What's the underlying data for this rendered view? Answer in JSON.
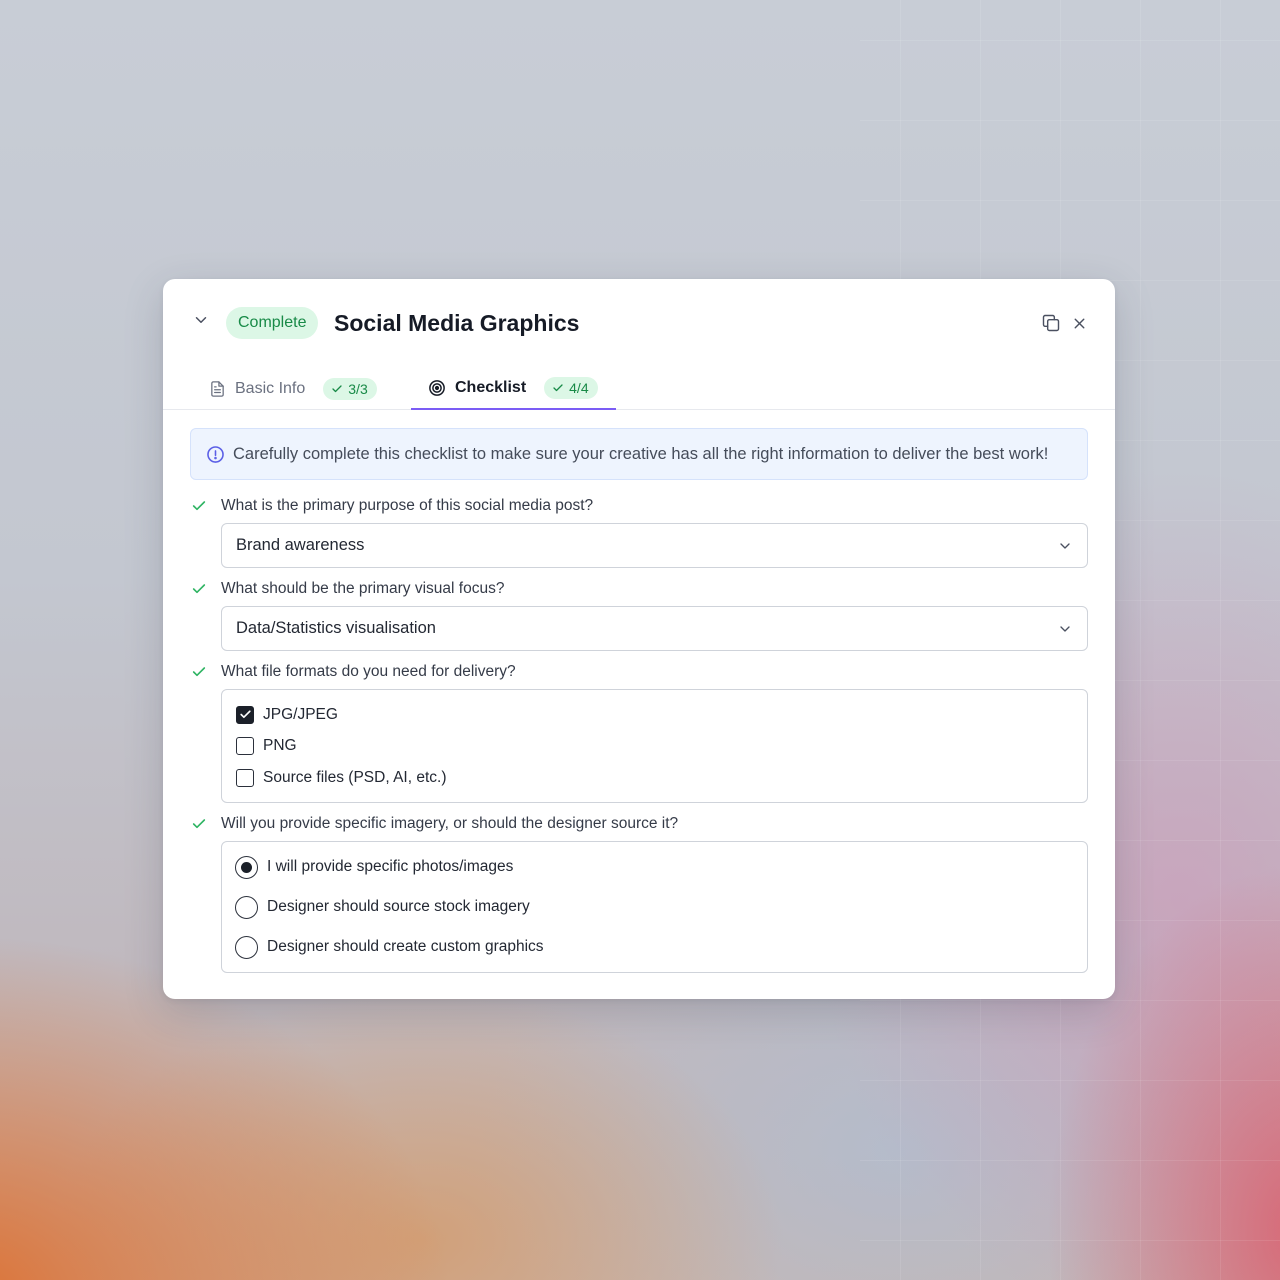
{
  "colors": {
    "accent_purple": "#7b5cf5",
    "success_green": "#188a47",
    "success_bg": "#dcf7e6",
    "info_bg": "#eef4fe",
    "info_icon": "#5b5fe6"
  },
  "header": {
    "status": "Complete",
    "title": "Social Media Graphics",
    "icons": [
      "chevron-down-icon",
      "copy-icon",
      "close-icon"
    ]
  },
  "tabs": [
    {
      "label": "Basic Info",
      "icon": "document-icon",
      "badge": "3/3",
      "active": false
    },
    {
      "label": "Checklist",
      "icon": "target-icon",
      "badge": "4/4",
      "active": true
    }
  ],
  "info": {
    "text": "Carefully complete this checklist to make sure your creative has all the right information to deliver the best work!"
  },
  "questions": [
    {
      "label": "What is the primary purpose of this social media post?",
      "type": "select",
      "value": "Brand awareness"
    },
    {
      "label": "What should be the primary visual focus?",
      "type": "select",
      "value": "Data/Statistics visualisation"
    },
    {
      "label": "What file formats do you need for delivery?",
      "type": "checkbox",
      "options": [
        {
          "label": "JPG/JPEG",
          "checked": true
        },
        {
          "label": "PNG",
          "checked": false
        },
        {
          "label": "Source files (PSD, AI, etc.)",
          "checked": false
        }
      ]
    },
    {
      "label": "Will you provide specific imagery, or should the designer source it?",
      "type": "radio",
      "options": [
        {
          "label": "I will provide specific photos/images",
          "selected": true
        },
        {
          "label": "Designer should source stock imagery",
          "selected": false
        },
        {
          "label": "Designer should create custom graphics",
          "selected": false
        }
      ]
    }
  ]
}
